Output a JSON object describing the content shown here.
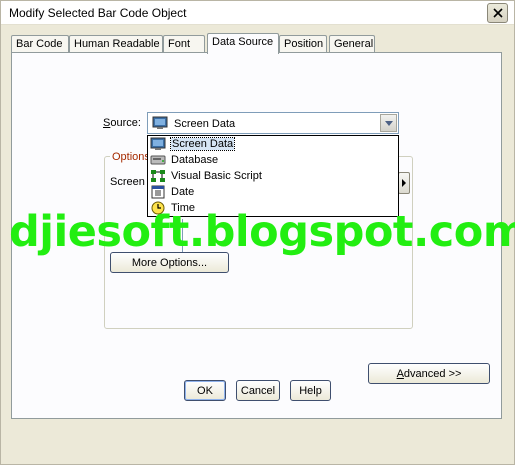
{
  "window": {
    "title": "Modify Selected Bar Code Object"
  },
  "tabs": [
    {
      "label": "Bar Code"
    },
    {
      "label": "Human Readable"
    },
    {
      "label": "Font"
    },
    {
      "label": "Data Source",
      "active": true
    },
    {
      "label": "Position"
    },
    {
      "label": "General"
    }
  ],
  "source": {
    "label_pre": "S",
    "label_rest": "ource:",
    "selected_value": "Screen Data",
    "selected_icon": "monitor-icon"
  },
  "dropdown": {
    "items": [
      {
        "label": "Screen Data",
        "icon": "monitor-icon",
        "selected": true
      },
      {
        "label": "Database",
        "icon": "database-icon"
      },
      {
        "label": "Visual Basic Script",
        "icon": "script-flowchart-icon"
      },
      {
        "label": "Date",
        "icon": "calendar-icon"
      },
      {
        "label": "Time",
        "icon": "clock-icon"
      }
    ]
  },
  "options": {
    "legend": "Options",
    "screen_label": "Screen",
    "more_options_label": "More Options..."
  },
  "watermark": "djiesoft.blogspot.com",
  "advanced": {
    "pre": "A",
    "rest": "dvanced >>"
  },
  "footer": {
    "ok_label": "OK",
    "cancel_label": "Cancel",
    "help_label": "Help"
  },
  "colors": {
    "watermark": "#22ee11",
    "options_legend": "#a52a00",
    "selection": "#d6e5f5"
  }
}
